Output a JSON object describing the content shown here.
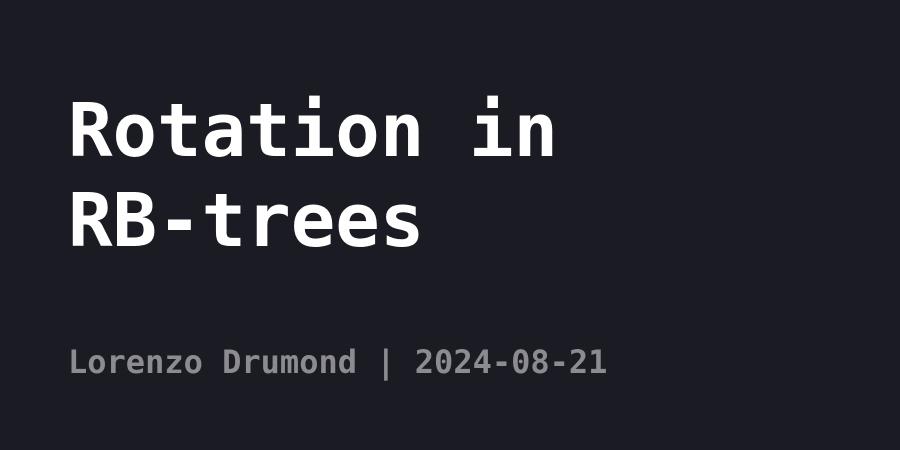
{
  "title": {
    "line1": "Rotation in",
    "line2": "RB-trees"
  },
  "meta": {
    "author": "Lorenzo Drumond",
    "separator": "|",
    "date": "2024-08-21"
  },
  "colors": {
    "background": "#1b1c23",
    "title": "#ffffff",
    "meta": "#8b8b91"
  }
}
